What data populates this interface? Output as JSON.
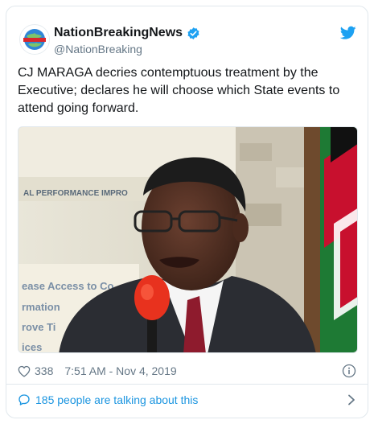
{
  "tweet": {
    "author_name": "NationBreakingNews",
    "author_handle": "@NationBreaking",
    "text": "CJ MARAGA decries contemptuous treatment by the Executive; declares he will choose which State events to attend going forward.",
    "likes": "338",
    "timestamp": "7:51 AM - Nov 4, 2019",
    "conversation": "185 people are talking about this"
  },
  "media": {
    "signage_text": "AL PERFORMANCE IMPRO",
    "poster_lines": [
      "ease  Access to Co",
      "rmation",
      "rove  Ti",
      "ices"
    ]
  },
  "icons": {
    "avatar": "globe-logo-avatar",
    "verified": "verified-badge-icon",
    "brand": "twitter-bird-icon",
    "like": "heart-icon",
    "info": "info-icon",
    "conversation": "speech-bubble-icon",
    "chevron": "chevron-right-icon"
  },
  "colors": {
    "accent": "#1da1f2",
    "link": "#1b95e0",
    "muted": "#657786",
    "border": "#e1e8ed",
    "text": "#14171a"
  }
}
